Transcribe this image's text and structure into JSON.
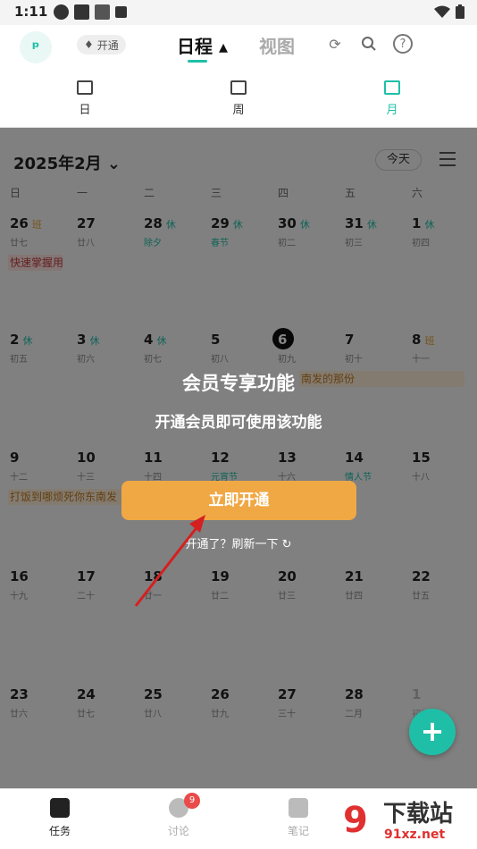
{
  "status_bar": {
    "time": "1:11"
  },
  "header": {
    "vip_label": "开通",
    "tab_active": "日程 ▴",
    "tab_inactive": "视图"
  },
  "view_tabs": [
    {
      "label": "日"
    },
    {
      "label": "周"
    },
    {
      "label": "月"
    }
  ],
  "calendar": {
    "month_title": "2025年2月 ⌄",
    "today_button": "今天",
    "weekdays": [
      "日",
      "一",
      "二",
      "三",
      "四",
      "五",
      "六"
    ],
    "weeks": [
      [
        {
          "day": "26",
          "tag": "班",
          "tag_type": "work",
          "lunar": "廿七"
        },
        {
          "day": "27",
          "tag": "",
          "lunar": "廿八"
        },
        {
          "day": "28",
          "tag": "休",
          "tag_type": "off",
          "lunar": "除夕",
          "festival": true
        },
        {
          "day": "29",
          "tag": "休",
          "tag_type": "off",
          "lunar": "春节",
          "festival": true
        },
        {
          "day": "30",
          "tag": "休",
          "tag_type": "off",
          "lunar": "初二"
        },
        {
          "day": "31",
          "tag": "休",
          "tag_type": "off",
          "lunar": "初三"
        },
        {
          "day": "1",
          "tag": "休",
          "tag_type": "off",
          "lunar": "初四"
        }
      ],
      [
        {
          "day": "2",
          "tag": "休",
          "tag_type": "off",
          "lunar": "初五"
        },
        {
          "day": "3",
          "tag": "休",
          "tag_type": "off",
          "lunar": "初六"
        },
        {
          "day": "4",
          "tag": "休",
          "tag_type": "off",
          "lunar": "初七"
        },
        {
          "day": "5",
          "tag": "",
          "lunar": "初八"
        },
        {
          "day": "6",
          "tag": "",
          "lunar": "初九",
          "today": true
        },
        {
          "day": "7",
          "tag": "",
          "lunar": "初十"
        },
        {
          "day": "8",
          "tag": "班",
          "tag_type": "work",
          "lunar": "十一"
        }
      ],
      [
        {
          "day": "9",
          "tag": "",
          "lunar": "十二"
        },
        {
          "day": "10",
          "tag": "",
          "lunar": "十三"
        },
        {
          "day": "11",
          "tag": "",
          "lunar": "十四"
        },
        {
          "day": "12",
          "tag": "",
          "lunar": "元宵节",
          "festival": true
        },
        {
          "day": "13",
          "tag": "",
          "lunar": "十六"
        },
        {
          "day": "14",
          "tag": "",
          "lunar": "情人节",
          "festival": true
        },
        {
          "day": "15",
          "tag": "",
          "lunar": "十八"
        }
      ],
      [
        {
          "day": "16",
          "tag": "",
          "lunar": "十九"
        },
        {
          "day": "17",
          "tag": "",
          "lunar": "二十"
        },
        {
          "day": "18",
          "tag": "",
          "lunar": "廿一"
        },
        {
          "day": "19",
          "tag": "",
          "lunar": "廿二"
        },
        {
          "day": "20",
          "tag": "",
          "lunar": "廿三"
        },
        {
          "day": "21",
          "tag": "",
          "lunar": "廿四"
        },
        {
          "day": "22",
          "tag": "",
          "lunar": "廿五"
        }
      ],
      [
        {
          "day": "23",
          "tag": "",
          "lunar": "廿六"
        },
        {
          "day": "24",
          "tag": "",
          "lunar": "廿七"
        },
        {
          "day": "25",
          "tag": "",
          "lunar": "廿八"
        },
        {
          "day": "26",
          "tag": "",
          "lunar": "廿九"
        },
        {
          "day": "27",
          "tag": "",
          "lunar": "三十"
        },
        {
          "day": "28",
          "tag": "",
          "lunar": "二月"
        },
        {
          "day": "1",
          "tag": "",
          "lunar": "初二",
          "dim": true
        }
      ]
    ],
    "events": [
      {
        "text": "快速掌握用",
        "week": 0,
        "col": 0,
        "span": 1,
        "color": "red"
      },
      {
        "text": "南发的那份",
        "week": 1,
        "col": 4,
        "span": 3,
        "color": "orange"
      },
      {
        "text": "打饭到哪烦死你东南发",
        "week": 2,
        "col": 0,
        "span": 2,
        "color": "orange"
      }
    ]
  },
  "overlay": {
    "title": "会员专享功能",
    "subtitle": "开通会员即可使用该功能",
    "button": "立即开通",
    "refresh": "开通了？刷新一下 ↻"
  },
  "fab": {
    "label": "+"
  },
  "bottom_nav": [
    {
      "label": "任务",
      "active": true
    },
    {
      "label": "讨论",
      "badge": "9"
    },
    {
      "label": "笔记"
    }
  ],
  "watermark": {
    "big": "下载站",
    "small": "91xz.net",
    "logo": "9"
  },
  "colors": {
    "accent": "#1fbfa7",
    "button": "#f0a845",
    "work_tag": "#e0a030"
  }
}
